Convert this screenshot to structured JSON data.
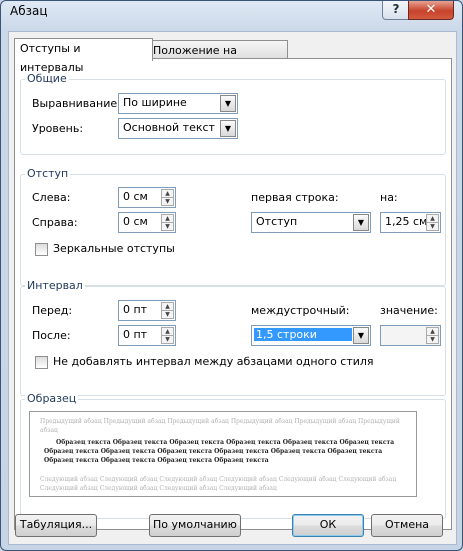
{
  "window": {
    "title": "Абзац",
    "help_label": "?",
    "close_label": "✕"
  },
  "tabs": [
    {
      "label": "Отступы и интервалы"
    },
    {
      "label": "Положение на странице"
    }
  ],
  "general": {
    "section_label": "Общие",
    "alignment_label": "Выравнивание:",
    "alignment_value": "По ширине",
    "level_label": "Уровень:",
    "level_value": "Основной текст"
  },
  "indent": {
    "section_label": "Отступ",
    "left_label": "Слева:",
    "left_value": "0 см",
    "right_label": "Справа:",
    "right_value": "0 см",
    "first_line_label": "первая строка:",
    "first_line_value": "Отступ",
    "by_label": "на:",
    "by_value": "1,25 см",
    "mirror_label": "Зеркальные отступы"
  },
  "spacing": {
    "section_label": "Интервал",
    "before_label": "Перед:",
    "before_value": "0 пт",
    "after_label": "После:",
    "after_value": "0 пт",
    "line_spacing_label": "междустрочный:",
    "line_spacing_value": "1,5 строки",
    "value_label": "значение:",
    "value_value": "",
    "no_space_label": "Не добавлять интервал между абзацами одного стиля"
  },
  "preview": {
    "section_label": "Образец",
    "prev_text": "Предыдущий абзац Предыдущий абзац Предыдущий абзац Предыдущий абзац Предыдущий абзац Предыдущий абзац",
    "sample_text": "Образец текста Образец текста Образец текста Образец текста Образец текста Образец текста Образец текста Образец текста Образец текста Образец текста Образец текста Образец текста Образец текста Образец текста Образец текста Образец текста",
    "next_text": "Следующий абзац Следующий абзац Следующий абзац Следующий абзац Следующий абзац Следующий абзац Следующий абзац Следующий абзац Следующий абзац Следующий абзац"
  },
  "buttons": {
    "tabs_label": "Табуляция...",
    "default_label": "По умолчанию",
    "ok_label": "ОК",
    "cancel_label": "Отмена"
  }
}
